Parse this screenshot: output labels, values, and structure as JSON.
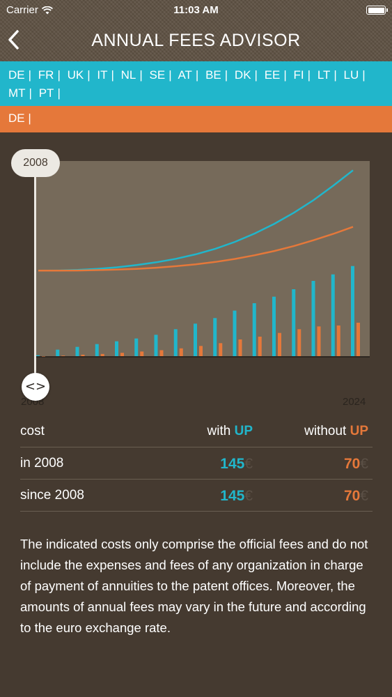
{
  "status_bar": {
    "carrier": "Carrier",
    "time": "11:03 AM"
  },
  "header": {
    "title": "ANNUAL FEES ADVISOR",
    "back_icon": "chevron-left-icon"
  },
  "countries": [
    "DE",
    "FR",
    "UK",
    "IT",
    "NL",
    "SE",
    "AT",
    "BE",
    "DK",
    "EE",
    "FI",
    "LT",
    "LU",
    "MT",
    "PT"
  ],
  "selected": {
    "label": "DE |"
  },
  "slider": {
    "year": "2008",
    "axis_start": "2008",
    "axis_end": "2024"
  },
  "colors": {
    "teal": "#21b6cb",
    "orange": "#e5783a",
    "background": "#453a30",
    "plot_bg": "#766a5a"
  },
  "chart_data": {
    "type": "bar",
    "x": [
      2008,
      2009,
      2010,
      2011,
      2012,
      2013,
      2014,
      2015,
      2016,
      2017,
      2018,
      2019,
      2020,
      2021,
      2022,
      2023,
      2024
    ],
    "xlim": [
      2008,
      2024
    ],
    "series": [
      {
        "name": "with UP",
        "color": "#21b6cb",
        "values": [
          0.05,
          0.35,
          0.5,
          0.65,
          0.8,
          0.95,
          1.15,
          1.45,
          1.75,
          2.05,
          2.45,
          2.85,
          3.2,
          3.6,
          4.05,
          4.4,
          4.85
        ]
      },
      {
        "name": "without UP",
        "color": "#e5783a",
        "values": [
          0,
          0.03,
          0.08,
          0.12,
          0.18,
          0.25,
          0.32,
          0.42,
          0.55,
          0.7,
          0.9,
          1.05,
          1.25,
          1.45,
          1.6,
          1.65,
          1.8
        ]
      }
    ],
    "curves": [
      {
        "name": "with UP",
        "color": "#21b6cb",
        "values": [
          4.6,
          4.61,
          4.64,
          4.7,
          4.78,
          4.9,
          5.05,
          5.24,
          5.48,
          5.78,
          6.15,
          6.6,
          7.12,
          7.72,
          8.4,
          9.18,
          10.0
        ]
      },
      {
        "name": "without UP",
        "color": "#e5783a",
        "values": [
          4.6,
          4.6,
          4.61,
          4.63,
          4.66,
          4.7,
          4.76,
          4.84,
          4.94,
          5.07,
          5.23,
          5.43,
          5.66,
          5.93,
          6.24,
          6.58,
          6.96
        ]
      }
    ],
    "ylim": [
      0,
      10.5
    ]
  },
  "table": {
    "header": {
      "label": "cost",
      "with_prefix": "with",
      "without_prefix": "without",
      "up": "UP"
    },
    "rows": [
      {
        "label": "in 2008",
        "with_value": "145",
        "without_value": "70"
      },
      {
        "label": "since 2008",
        "with_value": "145",
        "without_value": "70"
      }
    ],
    "currency": "€"
  },
  "disclaimer": "The indicated costs only comprise the official fees and do not include the expenses and fees of any organization in charge of payment of annuities to the patent offices. Moreover, the amounts of annual fees may vary in the future and according to the euro exchange rate."
}
